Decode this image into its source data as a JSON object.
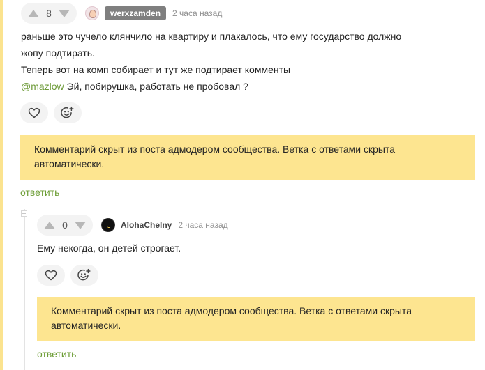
{
  "comments": [
    {
      "votes": "8",
      "username": "werxzamden",
      "time": "2 часа назад",
      "lines": [
        "раньше это чучело клянчило на квартиру и плакалось, что ему государство должно",
        "жопу подтирать.",
        "Теперь вот на комп собирает и тут же подтирает комменты"
      ],
      "mention": "@mazlow",
      "mention_text": " Эй, побирушка, работать не пробовал ?",
      "hidden_notice": "Комментарий скрыт из поста адмодером сообщества. Ветка с ответами скрыта автоматически.",
      "reply_label": "ответить"
    },
    {
      "votes": "0",
      "username": "AlohaChelny",
      "time": "2 часа назад",
      "lines": [
        "Ему некогда, он детей строгает."
      ],
      "hidden_notice": "Комментарий скрыт из поста адмодером сообщества. Ветка с ответами скрыта автоматически.",
      "reply_label": "ответить"
    }
  ],
  "icons": {
    "vote_up": "triangle-up-icon",
    "vote_down": "triangle-down-icon",
    "like": "heart-icon",
    "react": "emoji-add-icon",
    "thread": "collapse-thread-icon"
  },
  "colors": {
    "accent_green": "#6d9d36",
    "notice_yellow": "#fde590",
    "badge_gray": "#7f7f7f"
  }
}
